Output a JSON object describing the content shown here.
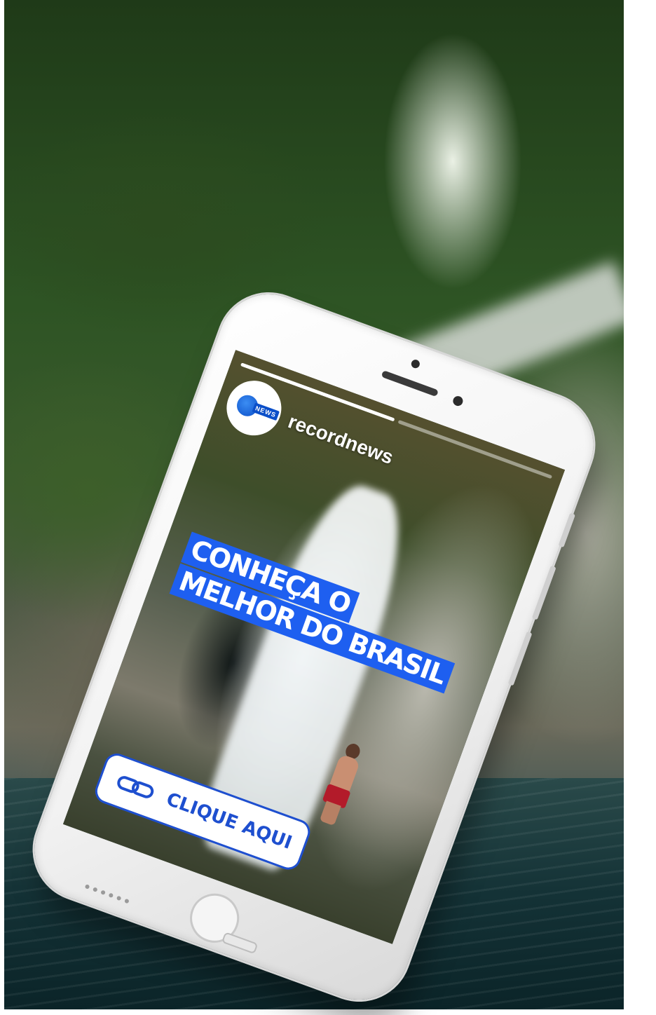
{
  "story": {
    "account_name": "recordnews",
    "avatar_badge": "NEWS",
    "headline_lines": [
      "CONHEÇA O",
      "MELHOR DO BRASIL"
    ],
    "cta_label": "CLIQUE AQUI",
    "progress": [
      1.0,
      0.0
    ]
  },
  "colors": {
    "brand_blue": "#1e5ff0",
    "cta_border": "#1e4fcf"
  },
  "icons": {
    "cta_icon": "link-icon",
    "avatar_logo": "record-news-globe-logo"
  }
}
